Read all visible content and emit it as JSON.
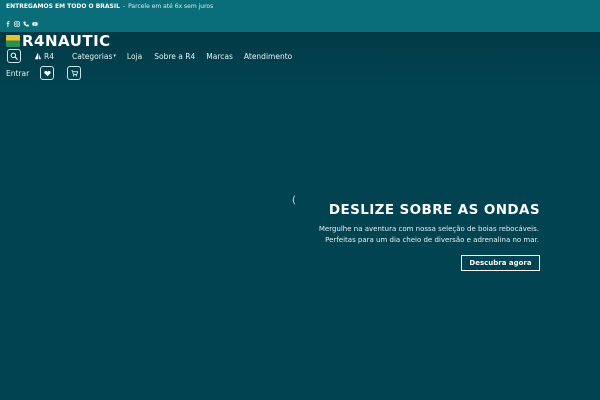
{
  "topbar": {
    "promo_bold": "ENTREGAMOS EM TODO O BRASIL",
    "separator": "-",
    "promo_light": "Parcele em até 6x sem juros",
    "socials": [
      "facebook-icon",
      "instagram-icon",
      "phone-icon",
      "youtube-icon"
    ]
  },
  "header": {
    "logo_text": "R4NAUTIC",
    "nav": {
      "r4": "R4",
      "categorias": "Categorias",
      "chevron": "▾",
      "loja": "Loja",
      "sobre": "Sobre a R4",
      "marcas": "Marcas",
      "atendimento": "Atendimento"
    },
    "account": {
      "entrar": "Entrar"
    }
  },
  "hero": {
    "loader": "(",
    "title": "DESLIZE SOBRE AS ONDAS",
    "subtitle_line1": "Mergulhe na aventura com nossa seleção de boias rebocáveis.",
    "subtitle_line2": "Perfeitas para um dia cheio de diversão e adrenalina no mar.",
    "cta": "Descubra agora"
  },
  "colors": {
    "topbar": "#0a6e7a",
    "background": "#014350",
    "text": "#ffffff"
  }
}
